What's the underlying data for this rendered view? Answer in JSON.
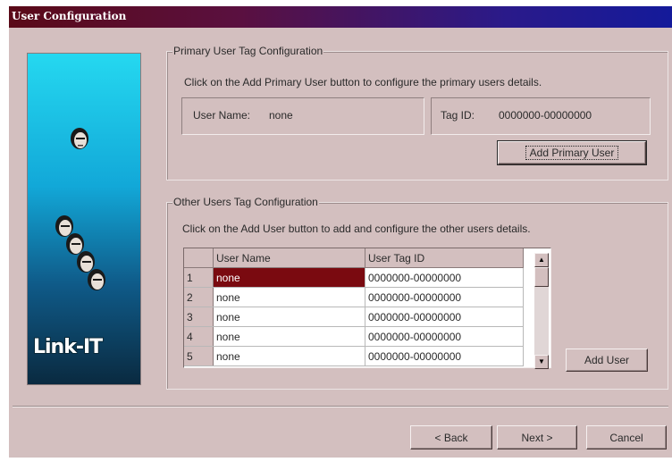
{
  "window": {
    "title": "User Configuration"
  },
  "side_panel": {
    "logo_text": "Link-IT",
    "face_icon": "face-icon"
  },
  "primary_group": {
    "legend": "Primary User Tag Configuration",
    "instruction": "Click on the Add Primary User button to configure the primary users details.",
    "user_name_label": "User Name:",
    "user_name_value": "none",
    "tag_id_label": "Tag ID:",
    "tag_id_value": "0000000-00000000",
    "add_button": "Add Primary User"
  },
  "other_group": {
    "legend": "Other Users Tag Configuration",
    "instruction": "Click on the Add User button to add and configure the other users details.",
    "columns": [
      "User Name",
      "User Tag ID"
    ],
    "rows": [
      {
        "num": "1",
        "name": "none",
        "tag": "0000000-00000000"
      },
      {
        "num": "2",
        "name": "none",
        "tag": "0000000-00000000"
      },
      {
        "num": "3",
        "name": "none",
        "tag": "0000000-00000000"
      },
      {
        "num": "4",
        "name": "none",
        "tag": "0000000-00000000"
      },
      {
        "num": "5",
        "name": "none",
        "tag": "0000000-00000000"
      }
    ],
    "add_button": "Add User"
  },
  "footer": {
    "back": "< Back",
    "next": "Next >",
    "cancel": "Cancel"
  },
  "colors": {
    "dialog_bg": "#d3bfbf",
    "selection": "#7a0a10",
    "title_start": "#5a0a18",
    "title_end": "#141a9a"
  }
}
